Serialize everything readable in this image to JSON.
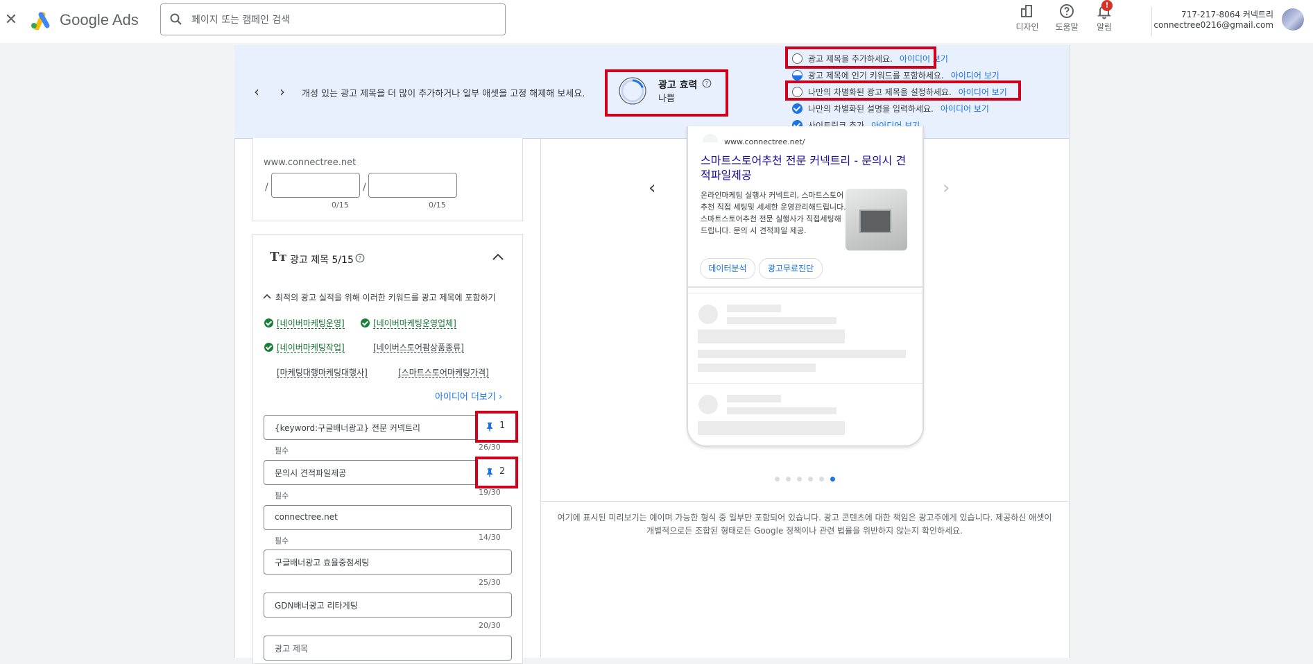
{
  "topbar": {
    "brand": "Google Ads",
    "search_placeholder": "페이지 또는 캠페인 검색",
    "nav": [
      {
        "label": "디자인",
        "icon": "design-icon"
      },
      {
        "label": "도움말",
        "icon": "help-icon"
      },
      {
        "label": "알림",
        "icon": "bell-icon"
      }
    ],
    "notification_badge": "!",
    "account_name": "717-217-8064 커넥트리",
    "account_email": "connectree0216@gmail.com"
  },
  "banner": {
    "message": "개성 있는 광고 제목을 더 많이 추가하거나 일부 애셋을 고정 해제해 보세요.",
    "strength_label": "광고 효력",
    "strength_value": "나쁨",
    "strength_level": 0.2,
    "tips": [
      {
        "text": "광고 제목을 추가하세요.",
        "link": "아이디어 보기",
        "state": "empty"
      },
      {
        "text": "광고 제목에 인기 키워드를 포함하세요.",
        "link": "아이디어 보기",
        "state": "half"
      },
      {
        "text": "나만의 차별화된 광고 제목을 설정하세요.",
        "link": "아이디어 보기",
        "state": "empty"
      },
      {
        "text": "나만의 차별화된 설명을 입력하세요.",
        "link": "아이디어 보기",
        "state": "done"
      },
      {
        "text": "사이트링크 추가",
        "link": "아이디어 보기",
        "state": "done"
      }
    ]
  },
  "url_panel": {
    "display_url": "www.connectree.net",
    "path1_counter": "0/15",
    "path2_counter": "0/15"
  },
  "headlines": {
    "title": "광고 제목 5/15",
    "keyword_hint": "최적의 광고 실적을 위해 이러한 키워드를 광고 제목에 포함하기",
    "keywords": [
      {
        "text": "[네이버마케팅운영]",
        "included": true
      },
      {
        "text": "[네이버마케팅운영업체]",
        "included": true
      },
      {
        "text": "[네이버마케팅작업]",
        "included": true
      },
      {
        "text": "[네이버스토어팜상품종류]",
        "included": false
      },
      {
        "text": "[마케팅대행마케팅대행사]",
        "included": false
      },
      {
        "text": "[스마트스토어마케팅가격]",
        "included": false
      }
    ],
    "more_ideas": "아이디어 더보기",
    "required_label": "필수",
    "fields": [
      {
        "value": "{keyword:구글배너광고} 전문 커넥트리",
        "counter": "26/30",
        "pin": "1"
      },
      {
        "value": "문의시 견적파일제공",
        "counter": "19/30",
        "pin": "2"
      },
      {
        "value": "connectree.net",
        "counter": "14/30"
      },
      {
        "value": "구글배너광고 효율중점세팅",
        "counter": "25/30"
      },
      {
        "value": "GDN배너광고 리타게팅",
        "counter": "20/30"
      },
      {
        "value": "광고 제목"
      }
    ]
  },
  "preview": {
    "ad_url": "www.connectree.net/",
    "ad_title": "스마트스토어추천 전문 커넥트리 - 문의시 견적파일제공",
    "ad_description": "온라인마케팅 실행사 커넥트리, 스마트스토어추천 직접 세팅및 세세한 운영관리해드립니다. 스마트스토어추천 전문 실행사가 직접세팅해드립니다. 문의 시 견적파일 제공.",
    "sitelinks": [
      "데이터분석",
      "광고무료진단"
    ],
    "carousel_count": 6,
    "carousel_active": 6,
    "disclaimer": "여기에 표시된 미리보기는 예이며 가능한 형식 중 일부만 포함되어 있습니다. 광고 콘텐츠에 대한 책임은 광고주에게 있습니다. 제공하신 애셋이 개별적으로든 조합된 형태로든 Google 정책이나 관련 법률을 위반하지 않는지 확인하세요."
  },
  "colors": {
    "accent": "#1a73e8",
    "highlight_box": "#d0021b",
    "keyword_included": "#137333",
    "banner_bg": "#e8f0fe"
  }
}
